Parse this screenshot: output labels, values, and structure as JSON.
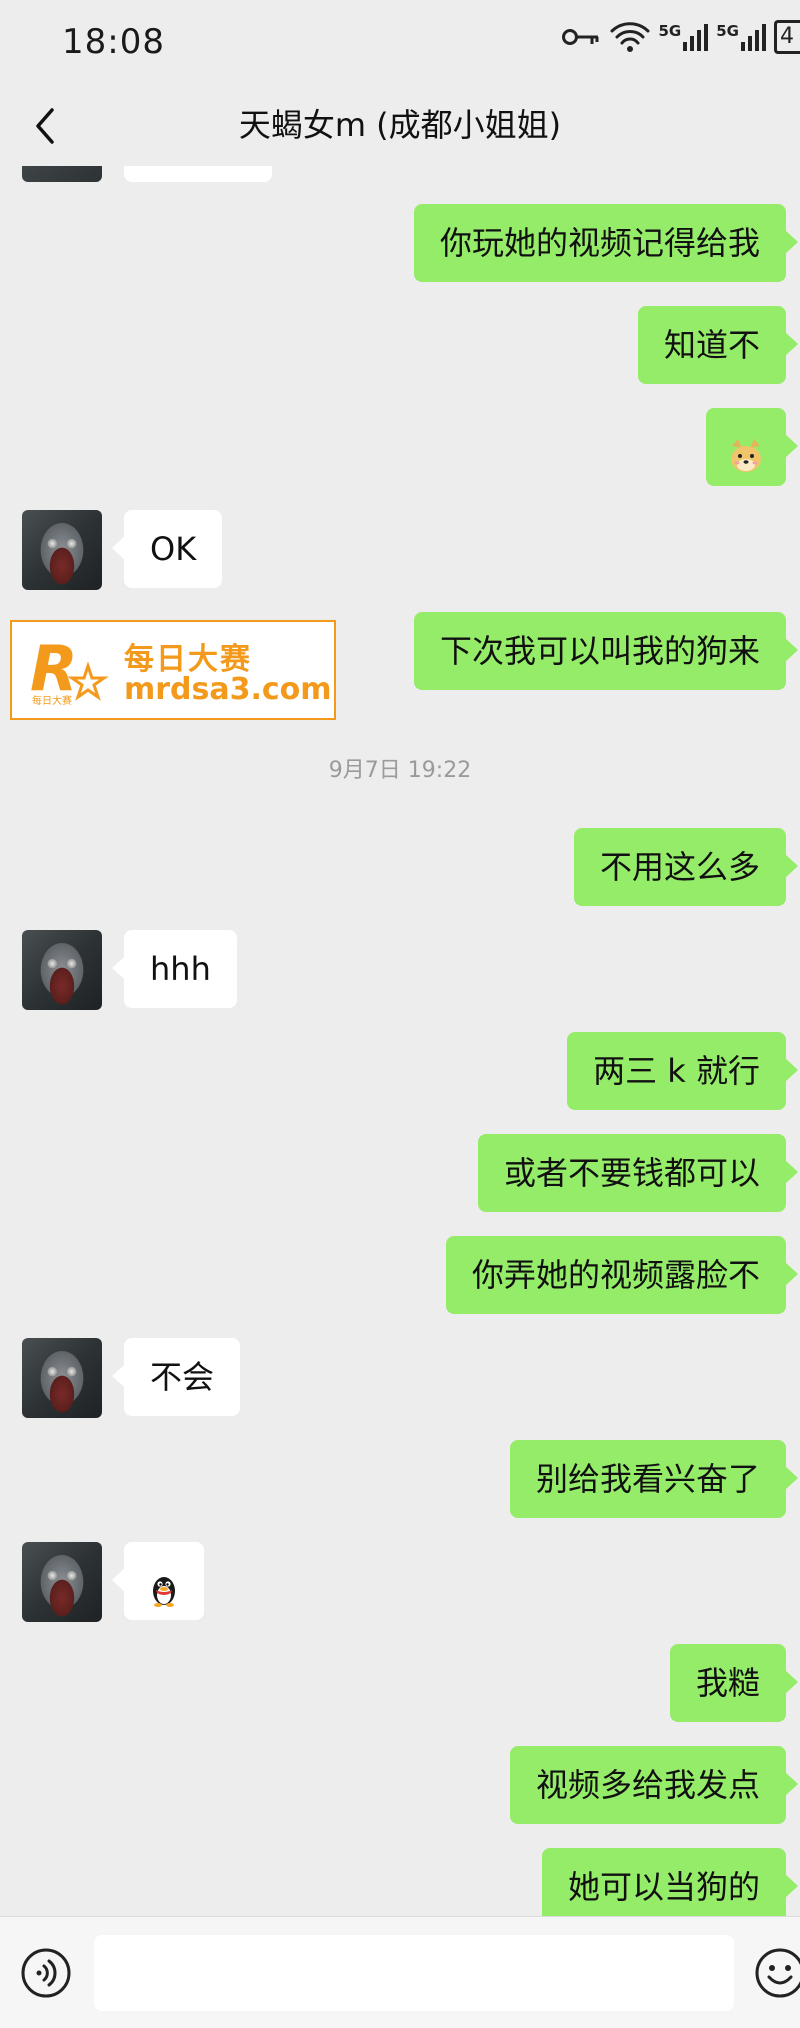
{
  "status_bar": {
    "time": "18:08",
    "network_1": "5G",
    "network_2": "5G",
    "battery": "4",
    "icons": [
      "key-icon",
      "wifi-icon",
      "signal-icon",
      "signal-icon",
      "battery-icon"
    ]
  },
  "header": {
    "title": "天蝎女m (成都小姐姐)",
    "back_icon": "chevron-left-icon"
  },
  "watermark": {
    "name": "每日大赛",
    "url": "mrdsa3.com",
    "logo_letter": "R",
    "logo_small_text": "每日大赛",
    "color": "#f39a1c"
  },
  "timestamp": "9月7日 19:22",
  "messages": [
    {
      "from": "me",
      "text": "你玩她的视频记得给我"
    },
    {
      "from": "me",
      "text": "知道不"
    },
    {
      "from": "me",
      "emoji": "doge-emoji"
    },
    {
      "from": "them",
      "text": "OK"
    },
    {
      "from": "me",
      "text": "下次我可以叫我的狗来"
    },
    {
      "from": "me",
      "text": "不用这么多"
    },
    {
      "from": "them",
      "text": "hhh"
    },
    {
      "from": "me",
      "text": "两三 k 就行"
    },
    {
      "from": "me",
      "text": "或者不要钱都可以"
    },
    {
      "from": "me",
      "text": "你弄她的视频露脸不"
    },
    {
      "from": "them",
      "text": "不会"
    },
    {
      "from": "me",
      "text": "别给我看兴奋了"
    },
    {
      "from": "them",
      "emoji": "penguin-emoji"
    },
    {
      "from": "me",
      "text": "我糙"
    },
    {
      "from": "me",
      "text": "视频多给我发点"
    },
    {
      "from": "me",
      "text": "她可以当狗的"
    }
  ],
  "colors": {
    "outgoing_bubble": "#95ec69",
    "incoming_bubble": "#ffffff",
    "background": "#ededed"
  },
  "input_bar": {
    "value": "",
    "voice_icon": "voice-icon",
    "emoji_icon": "emoji-icon"
  }
}
